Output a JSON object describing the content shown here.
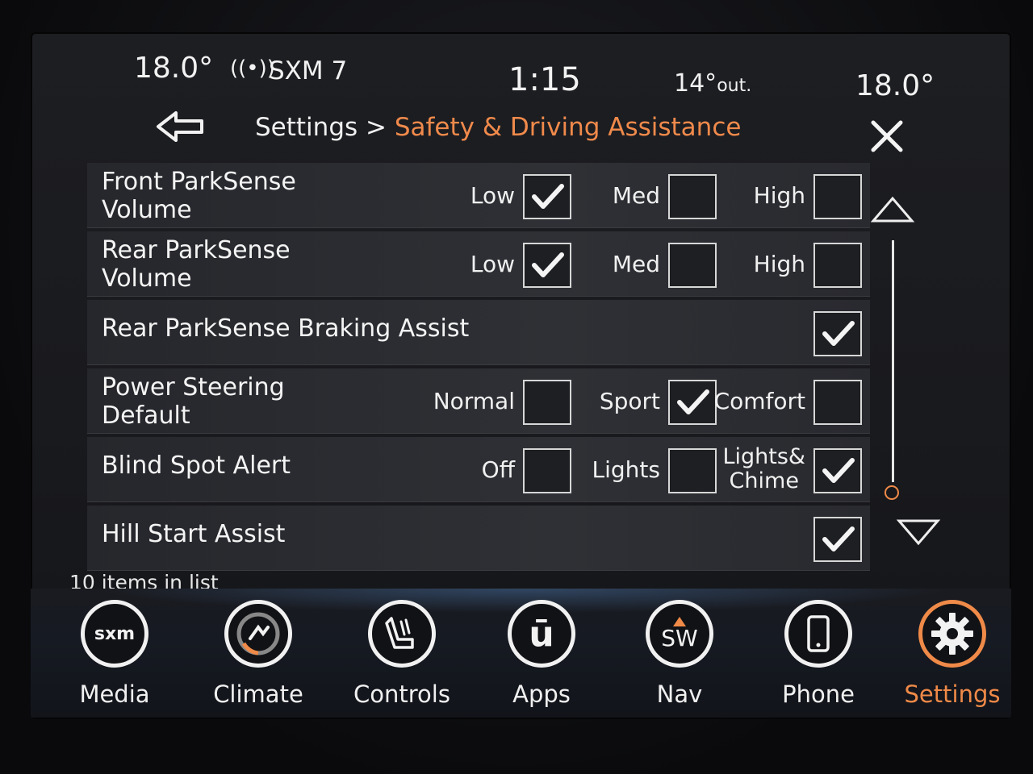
{
  "status": {
    "temp_left": "18.0°",
    "radio_icon": "radio-signal-icon",
    "station": "SXM 7",
    "time": "1:15",
    "outside_temp": "14°",
    "outside_suffix": "out.",
    "temp_right": "18.0°"
  },
  "header": {
    "breadcrumb_base": "Settings > ",
    "breadcrumb_current": "Safety & Driving Assistance",
    "accent_color": "#f08a4b"
  },
  "rows": [
    {
      "label": "Front ParkSense\nVolume",
      "options": [
        {
          "label": "Low",
          "checked": true
        },
        {
          "label": "Med",
          "checked": false
        },
        {
          "label": "High",
          "checked": false
        }
      ]
    },
    {
      "label": "Rear ParkSense\nVolume",
      "options": [
        {
          "label": "Low",
          "checked": true
        },
        {
          "label": "Med",
          "checked": false
        },
        {
          "label": "High",
          "checked": false
        }
      ]
    },
    {
      "label": "Rear ParkSense Braking Assist",
      "checked": true
    },
    {
      "label": "Power Steering\nDefault",
      "options": [
        {
          "label": "Normal",
          "checked": false
        },
        {
          "label": "Sport",
          "checked": true
        },
        {
          "label": "Comfort",
          "checked": false
        }
      ]
    },
    {
      "label": "Blind Spot Alert",
      "options": [
        {
          "label": "Off",
          "checked": false
        },
        {
          "label": "Lights",
          "checked": false
        },
        {
          "label": "Lights&\nChime",
          "checked": true
        }
      ]
    },
    {
      "label": "Hill Start Assist",
      "checked": true
    }
  ],
  "list_footer": "10 items in list",
  "nav": [
    {
      "label": "Media",
      "icon": "sxm-icon",
      "icon_text": "sxm",
      "active": false
    },
    {
      "label": "Climate",
      "icon": "climate-icon",
      "active": false
    },
    {
      "label": "Controls",
      "icon": "controls-seat-icon",
      "active": false
    },
    {
      "label": "Apps",
      "icon": "apps-icon",
      "icon_text": "ū",
      "active": false
    },
    {
      "label": "Nav",
      "icon": "compass-icon",
      "icon_text": "SW",
      "active": false
    },
    {
      "label": "Phone",
      "icon": "phone-icon",
      "active": false
    },
    {
      "label": "Settings",
      "icon": "gear-icon",
      "active": true
    }
  ]
}
